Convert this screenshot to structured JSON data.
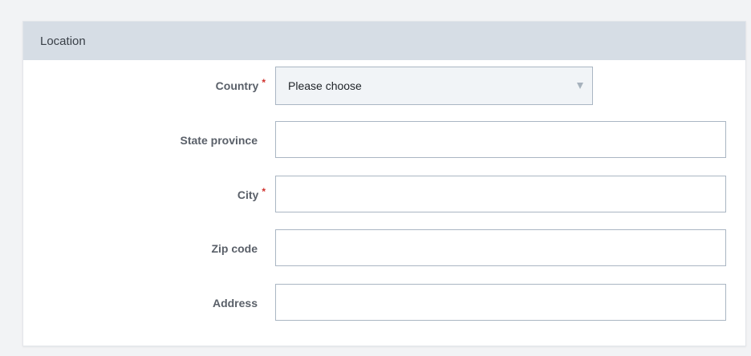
{
  "section": {
    "title": "Location"
  },
  "fields": {
    "country": {
      "label": "Country",
      "required_mark": "*",
      "value": "Please choose"
    },
    "state_province": {
      "label": "State province",
      "value": ""
    },
    "city": {
      "label": "City",
      "required_mark": "*",
      "value": ""
    },
    "zip_code": {
      "label": "Zip code",
      "value": ""
    },
    "address": {
      "label": "Address",
      "value": ""
    }
  },
  "colors": {
    "header_bg": "#d6dde5",
    "required": "#d0312d",
    "input_border": "#aab6c3"
  },
  "icons": {
    "select_caret": "chevron-down-icon"
  }
}
